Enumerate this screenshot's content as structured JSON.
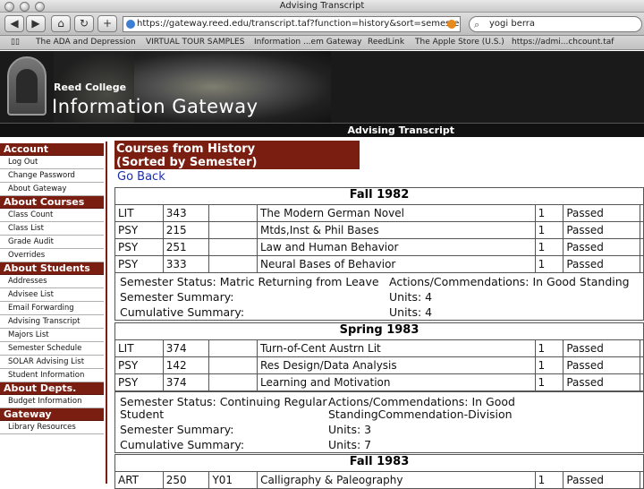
{
  "window": {
    "title": "Advising Transcript"
  },
  "toolbar": {
    "url": "https://gateway.reed.edu/transcript.taf?function=history&sort=semester",
    "search_value": "yogi berra"
  },
  "bookmarks": [
    "The ADA and Depression",
    "VIRTUAL TOUR SAMPLES",
    "Information ...em Gateway",
    "ReedLink",
    "The Apple Store (U.S.)",
    "https://admi...chcount.taf"
  ],
  "banner": {
    "college": "Reed College",
    "title": "Information Gateway",
    "page_label": "Advising Transcript"
  },
  "sidebar": [
    {
      "header": "Account",
      "items": [
        "Log Out",
        "Change Password",
        "About Gateway"
      ]
    },
    {
      "header": "About Courses",
      "items": [
        "Class Count",
        "Class List",
        "Grade Audit",
        "Overrides"
      ]
    },
    {
      "header": "About Students",
      "items": [
        "Addresses",
        "Advisee List",
        "Email Forwarding",
        "Advising Transcript",
        "Majors List",
        "Semester Schedule",
        "SOLAR Advising List",
        "Student Information"
      ]
    },
    {
      "header": "About Depts.",
      "items": [
        "Budget Information"
      ]
    },
    {
      "header": "Gateway",
      "items": [
        "Library Resources"
      ]
    }
  ],
  "content": {
    "heading_line1": "Courses from History",
    "heading_line2": "(Sorted by Semester)",
    "go_back": "Go Back"
  },
  "semesters": [
    {
      "name": "Fall 1982",
      "courses": [
        [
          "LIT",
          "343",
          "",
          "The Modern German Novel",
          "1",
          "Passed"
        ],
        [
          "PSY",
          "215",
          "",
          "Mtds,Inst & Phil Bases",
          "1",
          "Passed"
        ],
        [
          "PSY",
          "251",
          "",
          "Law and Human Behavior",
          "1",
          "Passed"
        ],
        [
          "PSY",
          "333",
          "",
          "Neural Bases of Behavior",
          "1",
          "Passed"
        ]
      ],
      "status": "Semester Status: Matric Returning from Leave",
      "actions": "Actions/Commendations: In Good Standing",
      "semester_summary": "Semester Summary:",
      "units1": "Units: 4",
      "cumulative_summary": "Cumulative Summary:",
      "units2": "Units: 4"
    },
    {
      "name": "Spring 1983",
      "courses": [
        [
          "LIT",
          "374",
          "",
          "Turn-of-Cent Austrn Lit",
          "1",
          "Passed"
        ],
        [
          "PSY",
          "142",
          "",
          "Res Design/Data Analysis",
          "1",
          "Passed"
        ],
        [
          "PSY",
          "374",
          "",
          "Learning and Motivation",
          "1",
          "Passed"
        ]
      ],
      "status_line1": "Semester Status: Continuing Regular",
      "status_line2": "Student",
      "actions_line1": "Actions/Commendations: In Good",
      "actions_line2": "StandingCommendation-Division",
      "semester_summary": "Semester Summary:",
      "units1": "Units: 3",
      "cumulative_summary": "Cumulative Summary:",
      "units2": "Units: 7"
    },
    {
      "name": "Fall 1983",
      "courses": [
        [
          "ART",
          "250",
          "Y01",
          "Calligraphy & Paleography",
          "1",
          "Passed"
        ]
      ]
    }
  ]
}
